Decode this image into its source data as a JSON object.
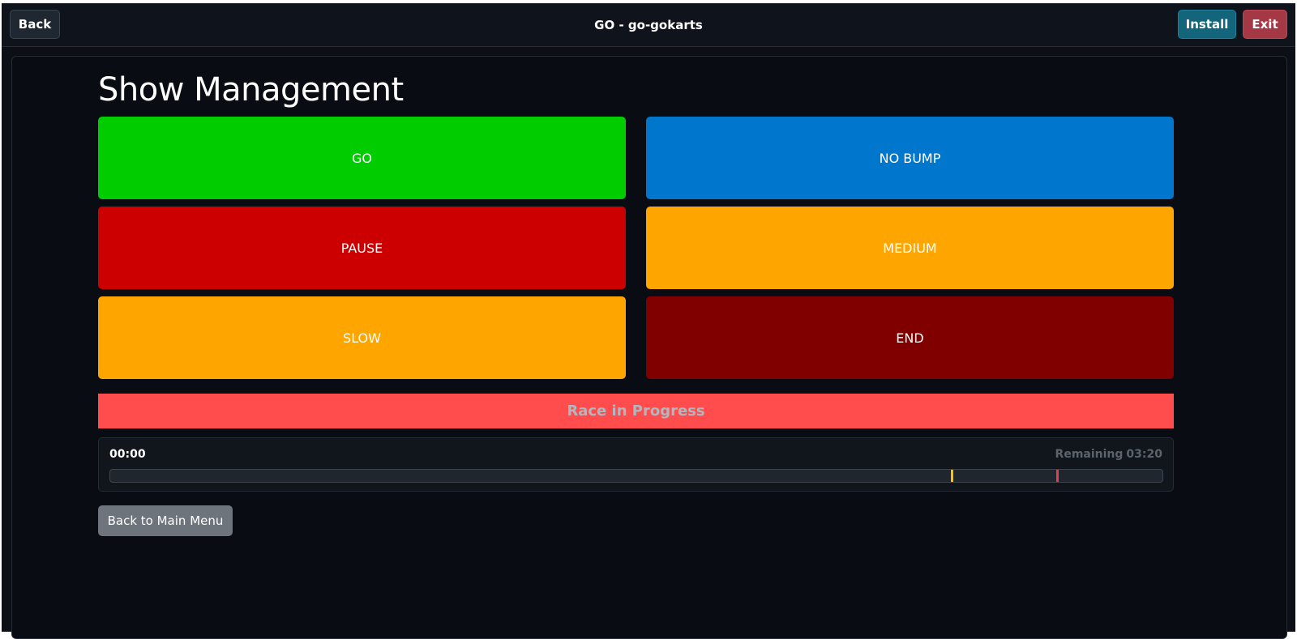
{
  "app": {
    "title": "GO - go-gokarts"
  },
  "topbar": {
    "back_label": "Back",
    "install_label": "Install",
    "exit_label": "Exit"
  },
  "page": {
    "title": "Show Management"
  },
  "controls": [
    {
      "id": "go",
      "label": "GO",
      "color": "#00cc00"
    },
    {
      "id": "no-bump",
      "label": "NO BUMP",
      "color": "#0077cc"
    },
    {
      "id": "pause",
      "label": "PAUSE",
      "color": "#cc0000"
    },
    {
      "id": "medium",
      "label": "MEDIUM",
      "color": "#ffa500"
    },
    {
      "id": "slow",
      "label": "SLOW",
      "color": "#ffa500"
    },
    {
      "id": "end",
      "label": "END",
      "color": "#800000"
    }
  ],
  "status": {
    "text": "Race in Progress",
    "background": "#ff4d4d",
    "text_color": "#b0b7be"
  },
  "timer": {
    "elapsed": "00:00",
    "remaining_label": "Remaining",
    "remaining": "03:20",
    "progress_fraction": 0,
    "markers": [
      {
        "name": "warning-marker",
        "fraction": 0.8,
        "color": "#ffc107"
      },
      {
        "name": "end-marker",
        "fraction": 0.9,
        "color": "#e0404a"
      }
    ]
  },
  "footer": {
    "main_menu_label": "Back to Main Menu"
  }
}
